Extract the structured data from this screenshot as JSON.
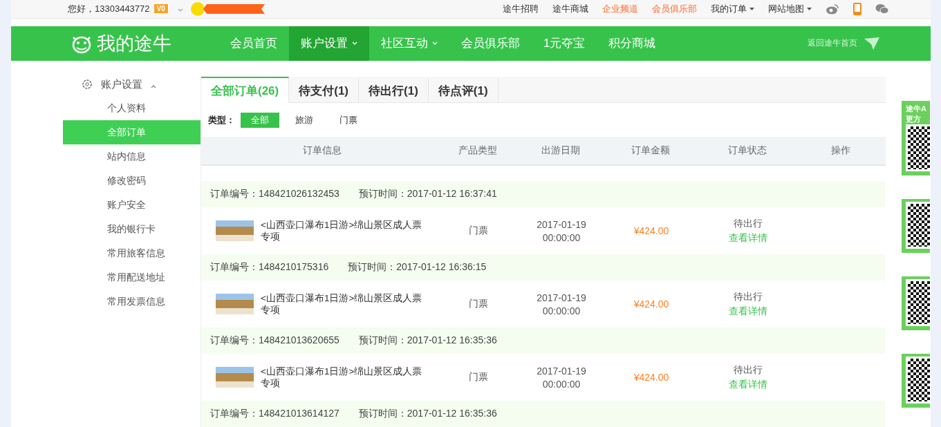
{
  "top_bar": {
    "greeting": "您好，",
    "phone": "13303443772",
    "vip_badge": "V0",
    "links": [
      {
        "label": "途牛招聘",
        "highlight": false,
        "dropdown": false
      },
      {
        "label": "途牛商城",
        "highlight": false,
        "dropdown": false
      },
      {
        "label": "企业频道",
        "highlight": true,
        "dropdown": false
      },
      {
        "label": "会员俱乐部",
        "highlight": true,
        "dropdown": false
      },
      {
        "label": "我的订单",
        "highlight": false,
        "dropdown": true
      },
      {
        "label": "网站地图",
        "highlight": false,
        "dropdown": true
      }
    ]
  },
  "nav": {
    "logo": "我的途牛",
    "items": [
      {
        "label": "会员首页",
        "selected": false,
        "dropdown": false
      },
      {
        "label": "账户设置",
        "selected": true,
        "dropdown": true
      },
      {
        "label": "社区互动",
        "selected": false,
        "dropdown": true
      },
      {
        "label": "会员俱乐部",
        "selected": false,
        "dropdown": false
      },
      {
        "label": "1元夺宝",
        "selected": false,
        "dropdown": false
      },
      {
        "label": "积分商城",
        "selected": false,
        "dropdown": false
      }
    ],
    "back_link": "返回途牛首页"
  },
  "sidebar": {
    "title": "账户设置",
    "expanded": true,
    "items": [
      {
        "label": "个人资料",
        "selected": false
      },
      {
        "label": "全部订单",
        "selected": true
      },
      {
        "label": "站内信息",
        "selected": false
      },
      {
        "label": "修改密码",
        "selected": false
      },
      {
        "label": "账户安全",
        "selected": false
      },
      {
        "label": "我的银行卡",
        "selected": false
      },
      {
        "label": "常用旅客信息",
        "selected": false
      },
      {
        "label": "常用配送地址",
        "selected": false
      },
      {
        "label": "常用发票信息",
        "selected": false
      }
    ]
  },
  "tabs": [
    {
      "label": "全部订单(26)",
      "selected": true
    },
    {
      "label": "待支付(1)",
      "selected": false
    },
    {
      "label": "待出行(1)",
      "selected": false
    },
    {
      "label": "待点评(1)",
      "selected": false
    }
  ],
  "filter": {
    "label": "类型：",
    "options": [
      {
        "label": "全部",
        "selected": true
      },
      {
        "label": "旅游",
        "selected": false
      },
      {
        "label": "门票",
        "selected": false
      }
    ]
  },
  "table": {
    "columns": [
      "订单信息",
      "产品类型",
      "出游日期",
      "订单金额",
      "订单状态",
      "操作"
    ],
    "orders": [
      {
        "number_label": "订单编号：",
        "number": "148421026132453",
        "time_label": "预订时间：",
        "time": "2017-01-12 16:37:41",
        "product": "<山西壶口瀑布1日游>绵山景区成人票专项",
        "type": "门票",
        "date": "2017-01-19",
        "clock": "00:00:00",
        "amount": "¥424.00",
        "status": "待出行",
        "action": "查看详情"
      },
      {
        "number_label": "订单编号：",
        "number": "1484210175316",
        "time_label": "预订时间：",
        "time": "2017-01-12 16:36:15",
        "product": "<山西壶口瀑布1日游>绵山景区成人票专项",
        "type": "门票",
        "date": "2017-01-19",
        "clock": "00:00:00",
        "amount": "¥424.00",
        "status": "待出行",
        "action": "查看详情"
      },
      {
        "number_label": "订单编号：",
        "number": "148421013620655",
        "time_label": "预订时间：",
        "time": "2017-01-12 16:35:36",
        "product": "<山西壶口瀑布1日游>绵山景区成人票专项",
        "type": "门票",
        "date": "2017-01-19",
        "clock": "00:00:00",
        "amount": "¥424.00",
        "status": "待出行",
        "action": "查看详情"
      },
      {
        "number_label": "订单编号：",
        "number": "148421013614127",
        "time_label": "预订时间：",
        "time": "2017-01-12 16:35:36"
      }
    ]
  },
  "side_ad": {
    "lines": [
      "途牛A",
      "更方"
    ]
  }
}
